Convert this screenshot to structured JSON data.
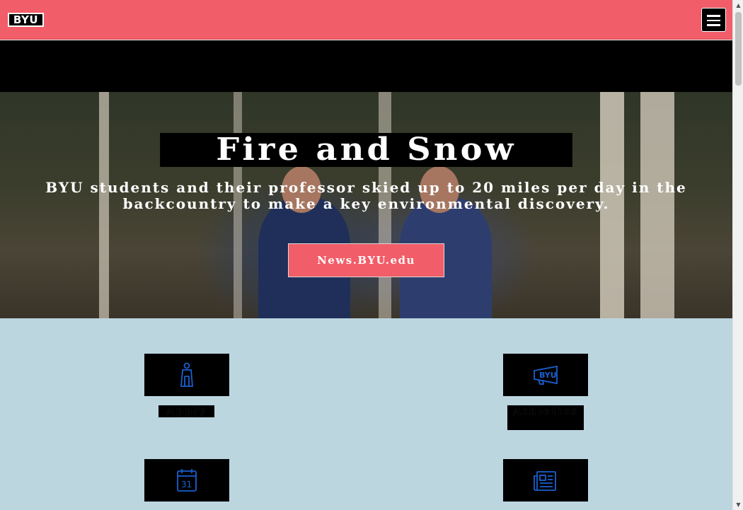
{
  "header": {
    "logo_text": "BYU",
    "menu_icon": "hamburger-menu-icon",
    "background_color": "#f15d68"
  },
  "hero": {
    "title": "Fire and Snow",
    "subtitle": "BYU students and their professor skied up to 20 miles per day in the backcountry to make a key environmental discovery.",
    "button_label": "News.BYU.edu",
    "button_color": "#f15d68"
  },
  "quick_links": {
    "background_color": "#bcd6e0",
    "icon_color": "#1a5fd0",
    "items": [
      {
        "label": "Apply",
        "icon": "graduate-figure-icon"
      },
      {
        "label": "Athletics",
        "icon": "byu-megaphone-icon"
      },
      {
        "label": "",
        "icon": "calendar-icon",
        "icon_text": "31"
      },
      {
        "label": "",
        "icon": "newspaper-icon"
      }
    ]
  },
  "scrollbar": {
    "up_arrow": "▲",
    "down_arrow": "▼"
  }
}
